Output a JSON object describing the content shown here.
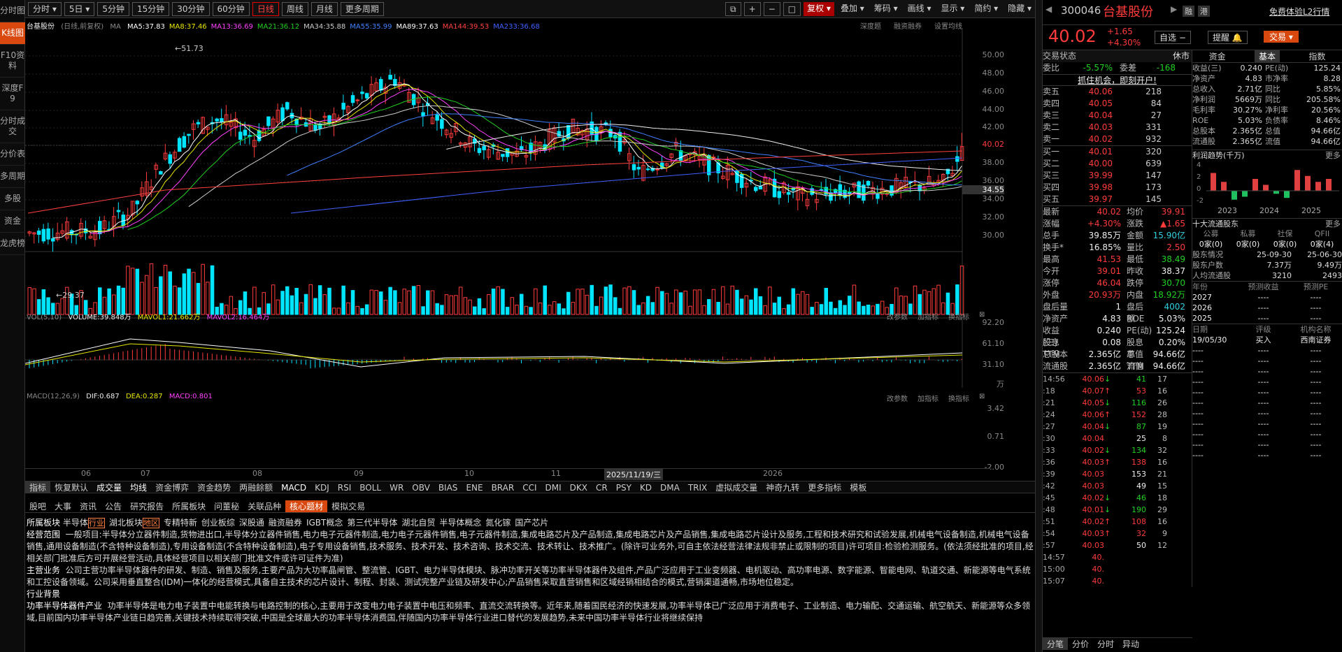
{
  "sidebar": [
    "分时图",
    "K线图",
    "F10资料",
    "深度F9",
    "分时成交",
    "分价表",
    "多周期",
    "多股",
    "资金",
    "龙虎榜"
  ],
  "toolbar": {
    "periods": [
      "分时",
      "5日",
      "5分钟",
      "15分钟",
      "30分钟",
      "60分钟",
      "日线",
      "周线",
      "月线",
      "更多周期"
    ],
    "active_period": "日线",
    "right": [
      "复权",
      "叠加",
      "筹码",
      "画线",
      "显示",
      "简约",
      "隐藏"
    ]
  },
  "chart": {
    "title": "台基股份",
    "subtitle": "(日线,前复权)",
    "ma_label": "MA",
    "ma": [
      {
        "t": "MA5:37.83",
        "c": "#ffffff"
      },
      {
        "t": "MA8:37.46",
        "c": "#e6e600"
      },
      {
        "t": "MA13:36.69",
        "c": "#ff40ff"
      },
      {
        "t": "MA21:36.12",
        "c": "#20d020"
      },
      {
        "t": "MA34:35.88",
        "c": "#cccccc"
      },
      {
        "t": "MA55:35.99",
        "c": "#4080ff"
      },
      {
        "t": "MA89:37.63",
        "c": "#ffffff"
      },
      {
        "t": "MA144:39.53",
        "c": "#ff4040"
      },
      {
        "t": "MA233:36.68",
        "c": "#4060ff"
      }
    ],
    "links": [
      "深度题",
      "融资融券",
      "设置均线"
    ],
    "price_ticks": [
      "50.00",
      "48.00",
      "46.00",
      "44.00",
      "42.00",
      "40.02",
      "38.00",
      "36.00",
      "34.55",
      "34.00",
      "32.00",
      "30.00"
    ],
    "high_label": "51.73",
    "low_label": "29.37",
    "vol_legend": {
      "name": "VOL(5,10)",
      "vol": "VOLUME:39.848万",
      "mavol1": "MAVOL1:21.662万",
      "mavol2": "MAVOL2:16.464万"
    },
    "vol_ticks": [
      "92.20",
      "61.10",
      "31.10",
      "万"
    ],
    "macd_legend": {
      "name": "MACD(12,26,9)",
      "dif": "DIF:0.687",
      "dea": "DEA:0.287",
      "macd": "MACD:0.801"
    },
    "macd_ticks": [
      "3.42",
      "0.71",
      "-2.00"
    ],
    "panel_links": [
      "改参数",
      "加指标",
      "换指标"
    ],
    "months": [
      "06",
      "07",
      "08",
      "09",
      "10",
      "11",
      "2026"
    ],
    "date_cursor": "2025/11/19/三"
  },
  "indicators": [
    "指标",
    "恢复默认",
    "成交量",
    "均线",
    "资金博弈",
    "资金趋势",
    "两融餘额",
    "MACD",
    "KDJ",
    "RSI",
    "BOLL",
    "WR",
    "OBV",
    "BIAS",
    "ENE",
    "BRAR",
    "CCI",
    "DMI",
    "DKX",
    "CR",
    "PSY",
    "KD",
    "DMA",
    "TRIX",
    "虚拟成交量",
    "神奇九转",
    "更多指标",
    "模板"
  ],
  "info_tabs": [
    "股吧",
    "大事",
    "资讯",
    "公告",
    "研究报告",
    "所属板块",
    "问董秘",
    "关联品种",
    "核心题材",
    "模拟交易"
  ],
  "info_active": "核心题材",
  "profile": {
    "sector_label": "所属板块",
    "sectors": [
      "半导体",
      "行业",
      "湖北板块",
      "地区",
      "专精特新",
      "创业板综",
      "深股通",
      "融资融券",
      "IGBT概念",
      "第三代半导体",
      "湖北自贸",
      "半导体概念",
      "氮化镓",
      "国产芯片"
    ],
    "scope_label": "经营范围",
    "scope": "一般项目:半导体分立器件制造,货物进出口,半导体分立器件销售,电力电子元器件制造,电力电子元器件销售,电子元器件制造,集成电路芯片及产品制造,集成电路芯片及产品销售,集成电路芯片设计及服务,工程和技术研究和试验发展,机械电气设备制造,机械电气设备销售,通用设备制造(不含特种设备制造),专用设备制造(不含特种设备制造),电子专用设备销售,技术服务、技术开发、技术咨询、技术交流、技术转让、技术推广。(除许可业务外,可自主依法经营法律法规非禁止或限制的项目)许可项目:检验检测服务。(依法须经批准的项目,经相关部门批准后方可开展经营活动,具体经营项目以相关部门批准文件或许可证件为准)",
    "main_label": "主营业务",
    "main": "公司主营功率半导体器件的研发、制造、销售及服务,主要产品为大功率晶闸管、整流管、IGBT、电力半导体模块、脉冲功率开关等功率半导体器件及组件,产品广泛应用于工业变频器、电机驱动、高功率电源、数字能源、智能电网、轨道交通、新能源等电气系统和工控设备领域。公司采用垂直整合(IDM)一体化的经营模式,具备自主技术的芯片设计、制程、封装、测试完整产业链及研发中心;产品销售采取直营销售和区域经销相结合的模式,营销渠道通畅,市场地位稳定。",
    "bg_label": "行业背景",
    "ind_label": "功率半导体器件产业",
    "ind": "功率半导体是电力电子装置中电能转换与电路控制的核心,主要用于改变电力电子装置中电压和频率、直流交流转换等。近年来,随着国民经济的快速发展,功率半导体已广泛应用于消费电子、工业制造、电力输配、交通运输、航空航天、新能源等众多领域,目前国内功率半导体产业链日趋完善,关键技术持续取得突破,中国是全球最大的功率半导体消费国,伴随国内功率半导体行业进口替代的发展趋势,未来中国功率半导体行业将继续保持"
  },
  "quote": {
    "code": "300046",
    "name": "台基股份",
    "price": "40.02",
    "chg": "+1.65",
    "pct": "+4.30%",
    "l2": "免费体验L2行情",
    "zx": "自选",
    "tx": "提醒",
    "jy": "交易",
    "status_label": "交易状态",
    "status": "休市",
    "wb_label": "委比",
    "wb": "-5.57%",
    "wc_label": "委差",
    "wc": "-168",
    "open_acct": "抓住机会，即刻开户!",
    "asks": [
      {
        "l": "卖五",
        "p": "40.06",
        "v": "218"
      },
      {
        "l": "卖四",
        "p": "40.05",
        "v": "84"
      },
      {
        "l": "卖三",
        "p": "40.04",
        "v": "27"
      },
      {
        "l": "卖二",
        "p": "40.03",
        "v": "331"
      },
      {
        "l": "卖一",
        "p": "40.02",
        "v": "932"
      }
    ],
    "bids": [
      {
        "l": "买一",
        "p": "40.01",
        "v": "320"
      },
      {
        "l": "买二",
        "p": "40.00",
        "v": "639"
      },
      {
        "l": "买三",
        "p": "39.99",
        "v": "147"
      },
      {
        "l": "买四",
        "p": "39.98",
        "v": "173"
      },
      {
        "l": "买五",
        "p": "39.97",
        "v": "145"
      }
    ],
    "stats": [
      [
        "最新",
        "40.02",
        "red",
        "均价",
        "39.91",
        "red"
      ],
      [
        "涨幅",
        "+4.30%",
        "red",
        "涨跌",
        "▲1.65",
        "red"
      ],
      [
        "总手",
        "39.85万",
        "white",
        "金额",
        "15.90亿",
        "cyan"
      ],
      [
        "换手*",
        "16.85%",
        "white",
        "量比",
        "2.50",
        "red"
      ],
      [
        "最高",
        "41.53",
        "red",
        "最低",
        "38.49",
        "green"
      ],
      [
        "今开",
        "39.01",
        "red",
        "昨收",
        "38.37",
        "white"
      ],
      [
        "涨停",
        "46.04",
        "red",
        "跌停",
        "30.70",
        "green"
      ],
      [
        "外盘",
        "20.93万",
        "red",
        "内盘",
        "18.92万",
        "green"
      ],
      [
        "盘后量",
        "1",
        "white",
        "盘后额",
        "4002",
        "cyan"
      ],
      [
        "净资产",
        "4.83",
        "white",
        "ROE",
        "5.03%",
        "white"
      ],
      [
        "收益(三)",
        "0.240",
        "white",
        "PE(动)",
        "125.24",
        "white"
      ],
      [
        "股息TTM",
        "0.08",
        "white",
        "股息率TTM",
        "0.20%",
        "white"
      ],
      [
        "总股本",
        "2.365亿",
        "white",
        "总值",
        "94.66亿",
        "white"
      ],
      [
        "流通股",
        "2.365亿",
        "white",
        "流值",
        "94.66亿",
        "white"
      ]
    ],
    "ticks": [
      [
        "14:56",
        "40.06",
        "↓",
        "41",
        "17",
        "red",
        "green"
      ],
      [
        ":18",
        "40.07",
        "↑",
        "53",
        "16",
        "red",
        "red"
      ],
      [
        ":21",
        "40.05",
        "↓",
        "116",
        "26",
        "red",
        "green"
      ],
      [
        ":24",
        "40.06",
        "↑",
        "152",
        "28",
        "red",
        "red"
      ],
      [
        ":27",
        "40.04",
        "↓",
        "87",
        "19",
        "red",
        "green"
      ],
      [
        ":30",
        "40.04",
        "",
        "25",
        "8",
        "red",
        "white"
      ],
      [
        ":33",
        "40.02",
        "↓",
        "134",
        "32",
        "red",
        "green"
      ],
      [
        ":36",
        "40.03",
        "↑",
        "138",
        "16",
        "red",
        "red"
      ],
      [
        ":39",
        "40.03",
        "",
        "153",
        "21",
        "red",
        "white"
      ],
      [
        ":42",
        "40.03",
        "",
        "49",
        "15",
        "red",
        "white"
      ],
      [
        ":45",
        "40.02",
        "↓",
        "46",
        "18",
        "red",
        "green"
      ],
      [
        ":48",
        "40.01",
        "↓",
        "190",
        "29",
        "red",
        "green"
      ],
      [
        ":51",
        "40.02",
        "↑",
        "108",
        "16",
        "red",
        "red"
      ],
      [
        ":54",
        "40.03",
        "↑",
        "32",
        "9",
        "red",
        "red"
      ],
      [
        ":57",
        "40.03",
        "",
        "50",
        "12",
        "red",
        "white"
      ],
      [
        "14:57",
        "40.",
        "",
        "",
        "",
        "red",
        "white"
      ],
      [
        "15:00",
        "40.",
        "",
        "",
        "",
        "red",
        "white"
      ],
      [
        "15:07",
        "40.",
        "",
        "",
        "",
        "red",
        "white"
      ]
    ],
    "bottom_tabs": [
      "分笔",
      "分价",
      "分时",
      "异动"
    ]
  },
  "f10": {
    "tabs": [
      "资金",
      "基本",
      "指数"
    ],
    "active": "基本",
    "rows": [
      [
        "收益(三)",
        "0.240",
        "PE(动)",
        "125.24"
      ],
      [
        "净资产",
        "4.83",
        "市净率",
        "8.28"
      ],
      [
        "总收入",
        "2.71亿",
        "同比",
        "5.85%"
      ],
      [
        "净利润",
        "5669万",
        "同比",
        "205.58%"
      ],
      [
        "毛利率",
        "30.27%",
        "净利率",
        "20.56%"
      ],
      [
        "ROE",
        "5.03%",
        "负债率",
        "8.46%"
      ],
      [
        "总股本",
        "2.365亿",
        "总值",
        "94.66亿"
      ],
      [
        "流通股",
        "2.365亿",
        "流值",
        "94.66亿"
      ]
    ],
    "profit_title": "利润趋势(千万)",
    "more": "更多",
    "profit_years": [
      "2023",
      "2024",
      "2025"
    ],
    "profit_ticks": [
      "4",
      "2",
      "0",
      "-2"
    ],
    "top10": "十大流通股东",
    "holder_cols": [
      "公募",
      "私募",
      "社保",
      "QFII"
    ],
    "holder_vals": [
      "0家(0)",
      "0家(0)",
      "0家(0)",
      "0家(4)"
    ],
    "holder_rows": [
      [
        "股东情况",
        "25-09-30",
        "25-06-30"
      ],
      [
        "股东户数",
        "7.37万",
        "9.49万"
      ],
      [
        "人均流通股",
        "3210",
        "2493"
      ]
    ],
    "fc_head": [
      "年份",
      "预测收益",
      "预测PE"
    ],
    "fc_rows": [
      [
        "2027",
        "----",
        "----"
      ],
      [
        "2026",
        "----",
        "----"
      ],
      [
        "2025",
        "----",
        "----"
      ]
    ],
    "rating_head": [
      "日期",
      "评级",
      "机构名称"
    ],
    "rating_rows": [
      [
        "19/05/30",
        "买入",
        "西南证券"
      ],
      [
        "----",
        "----",
        "----"
      ],
      [
        "----",
        "----",
        "----"
      ],
      [
        "----",
        "----",
        "----"
      ],
      [
        "----",
        "----",
        "----"
      ],
      [
        "----",
        "----",
        "----"
      ],
      [
        "----",
        "----",
        "----"
      ],
      [
        "----",
        "----",
        "----"
      ],
      [
        "----",
        "----",
        "----"
      ],
      [
        "----",
        "----",
        "----"
      ],
      [
        "----",
        "----",
        "----"
      ],
      [
        "----",
        "----",
        "----"
      ]
    ]
  },
  "colors": {
    "up": "#ff3b3b",
    "down": "#00e5ff",
    "orange": "#d9480f"
  }
}
